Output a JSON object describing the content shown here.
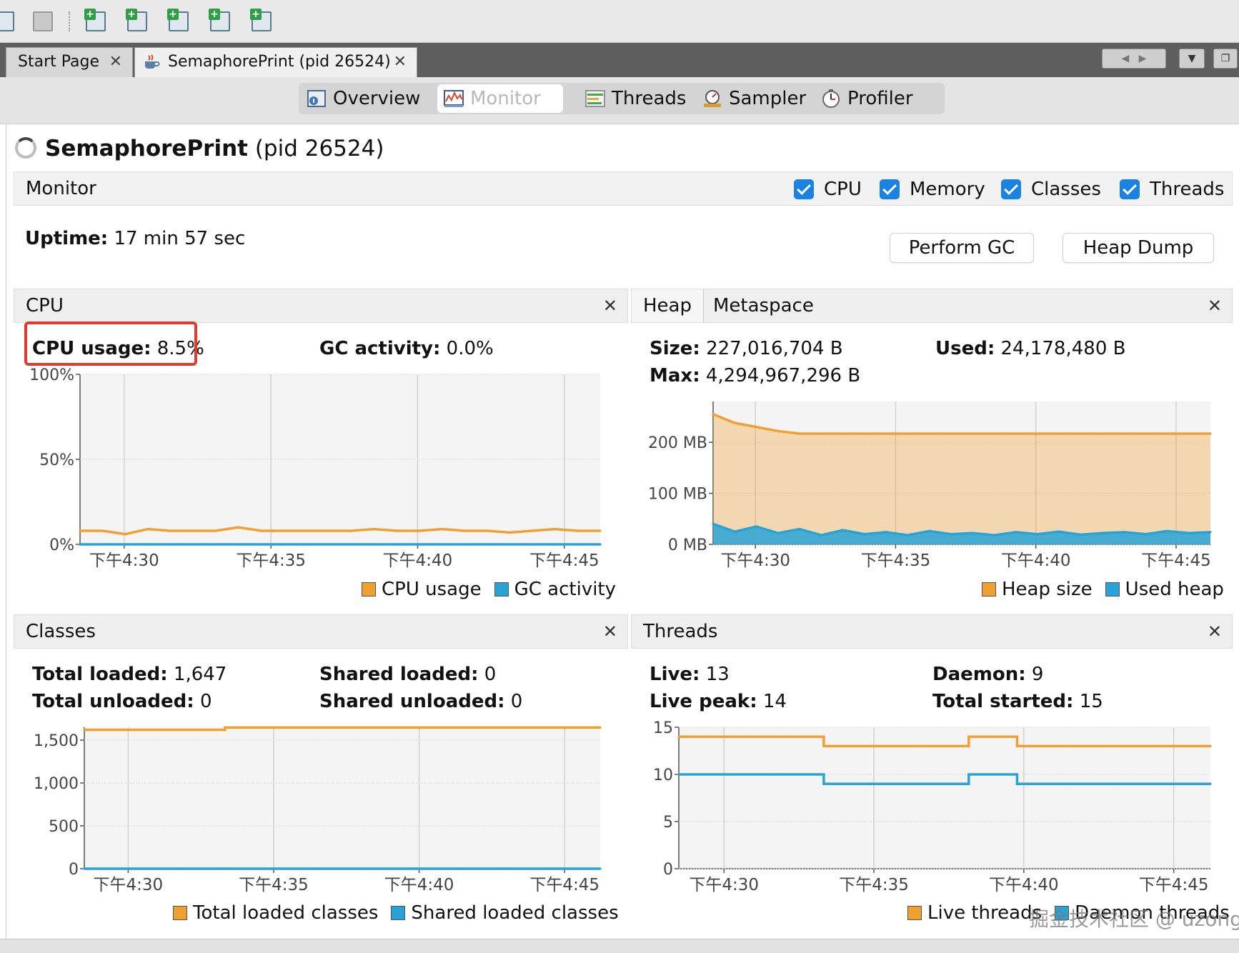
{
  "app": {
    "doc_tabs": [
      {
        "label": "Start Page"
      },
      {
        "label": "SemaphorePrint (pid 26524)"
      }
    ],
    "close_glyph": "✕"
  },
  "toolbar": {
    "icons": [
      "menu-icon",
      "save-all-icon",
      "add-application-icon",
      "add-jmx-connection-icon",
      "add-core-dump-icon",
      "add-heap-dump-icon",
      "add-snapshot-icon"
    ]
  },
  "subtabs": [
    {
      "label": "Overview",
      "icon": "overview-icon",
      "selected": false
    },
    {
      "label": "Monitor",
      "icon": "monitor-icon",
      "selected": true
    },
    {
      "label": "Threads",
      "icon": "threads-icon",
      "selected": false
    },
    {
      "label": "Sampler",
      "icon": "sampler-icon",
      "selected": false
    },
    {
      "label": "Profiler",
      "icon": "profiler-icon",
      "selected": false
    }
  ],
  "page": {
    "app_name": "SemaphorePrint",
    "pid_text": " (pid 26524)"
  },
  "monitor": {
    "label": "Monitor",
    "checkboxes": [
      {
        "label": "CPU",
        "checked": true
      },
      {
        "label": "Memory",
        "checked": true
      },
      {
        "label": "Classes",
        "checked": true
      },
      {
        "label": "Threads",
        "checked": true
      }
    ],
    "uptime_label": "Uptime:",
    "uptime_value": " 17 min 57 sec",
    "perform_gc": "Perform GC",
    "heap_dump": "Heap Dump"
  },
  "cpu_panel": {
    "title": "CPU",
    "cpu_usage_label": "CPU usage:",
    "cpu_usage_value": " 8.5%",
    "gc_activity_label": "GC activity:",
    "gc_activity_value": " 0.0%"
  },
  "heap_panel": {
    "tabs": [
      "Heap",
      "Metaspace"
    ],
    "size_label": "Size:",
    "size_value": " 227,016,704 B",
    "used_label": "Used:",
    "used_value": " 24,178,480 B",
    "max_label": "Max:",
    "max_value": " 4,294,967,296 B"
  },
  "classes_panel": {
    "title": "Classes",
    "total_loaded_label": "Total loaded:",
    "total_loaded_value": " 1,647",
    "total_unloaded_label": "Total unloaded:",
    "total_unloaded_value": " 0",
    "shared_loaded_label": "Shared loaded:",
    "shared_loaded_value": " 0",
    "shared_unloaded_label": "Shared unloaded:",
    "shared_unloaded_value": " 0"
  },
  "threads_panel": {
    "title": "Threads",
    "live_label": "Live:",
    "live_value": " 13",
    "live_peak_label": "Live peak:",
    "live_peak_value": " 14",
    "daemon_label": "Daemon:",
    "daemon_value": " 9",
    "total_started_label": "Total started:",
    "total_started_value": " 15"
  },
  "watermark": "掘金技术社区 @ uzong",
  "colors": {
    "orange": "#f0a030",
    "blue": "#29a3d6",
    "highlight_red": "#e03b2f",
    "checkbox_blue": "#1a82e2"
  },
  "chart_data": [
    {
      "id": "cpu",
      "type": "line",
      "x_ticks": [
        "下午4:30",
        "下午4:35",
        "下午4:40",
        "下午4:45"
      ],
      "y_ticks": [
        "100%",
        "50%",
        "0%"
      ],
      "ylim": [
        0,
        100
      ],
      "series": [
        {
          "name": "CPU usage",
          "color": "#f0a030",
          "values": [
            8,
            8,
            6,
            9,
            8,
            8,
            8,
            10,
            8,
            8,
            8,
            8,
            8,
            9,
            8,
            8,
            9,
            8,
            8,
            7,
            8,
            9,
            8,
            8
          ]
        },
        {
          "name": "GC activity",
          "color": "#29a3d6",
          "values": [
            0,
            0,
            0,
            0,
            0,
            0,
            0,
            0,
            0,
            0,
            0,
            0,
            0,
            0,
            0,
            0,
            0,
            0,
            0,
            0,
            0,
            0,
            0,
            0
          ]
        }
      ]
    },
    {
      "id": "heap",
      "type": "area",
      "x_ticks": [
        "下午4:30",
        "下午4:35",
        "下午4:40",
        "下午4:45"
      ],
      "y_ticks": [
        "200 MB",
        "100 MB",
        "0 MB"
      ],
      "ylim": [
        0,
        280
      ],
      "series": [
        {
          "name": "Heap size",
          "color": "#f0a030",
          "values": [
            255,
            238,
            230,
            222,
            217,
            217,
            217,
            217,
            217,
            217,
            217,
            217,
            217,
            217,
            217,
            217,
            217,
            217,
            217,
            217,
            217,
            217,
            217,
            217
          ]
        },
        {
          "name": "Used heap",
          "color": "#29a3d6",
          "values": [
            40,
            25,
            35,
            22,
            30,
            18,
            28,
            20,
            24,
            18,
            26,
            20,
            22,
            18,
            24,
            20,
            25,
            19,
            22,
            24,
            20,
            26,
            22,
            24
          ]
        }
      ]
    },
    {
      "id": "classes",
      "type": "line",
      "x_ticks": [
        "下午4:30",
        "下午4:35",
        "下午4:40",
        "下午4:45"
      ],
      "y_ticks": [
        "1,500",
        "1,000",
        "500",
        "0"
      ],
      "ylim": [
        0,
        1650
      ],
      "series": [
        {
          "name": "Total loaded classes",
          "color": "#f0a030",
          "values": [
            1620,
            1620,
            1620,
            1647,
            1647,
            1647,
            1647,
            1647,
            1647,
            1647,
            1647,
            1647
          ]
        },
        {
          "name": "Shared loaded classes",
          "color": "#29a3d6",
          "values": [
            0,
            0,
            0,
            0,
            0,
            0,
            0,
            0,
            0,
            0,
            0,
            0
          ]
        }
      ]
    },
    {
      "id": "threads",
      "type": "line",
      "x_ticks": [
        "下午4:30",
        "下午4:35",
        "下午4:40",
        "下午4:45"
      ],
      "y_ticks": [
        "15",
        "10",
        "5",
        "0"
      ],
      "ylim": [
        0,
        15
      ],
      "series": [
        {
          "name": "Live threads",
          "color": "#f0a030",
          "values": [
            14,
            14,
            14,
            13,
            13,
            13,
            14,
            13,
            13,
            13,
            13,
            13
          ]
        },
        {
          "name": "Daemon threads",
          "color": "#29a3d6",
          "values": [
            10,
            10,
            10,
            9,
            9,
            9,
            10,
            9,
            9,
            9,
            9,
            9
          ]
        }
      ]
    }
  ]
}
